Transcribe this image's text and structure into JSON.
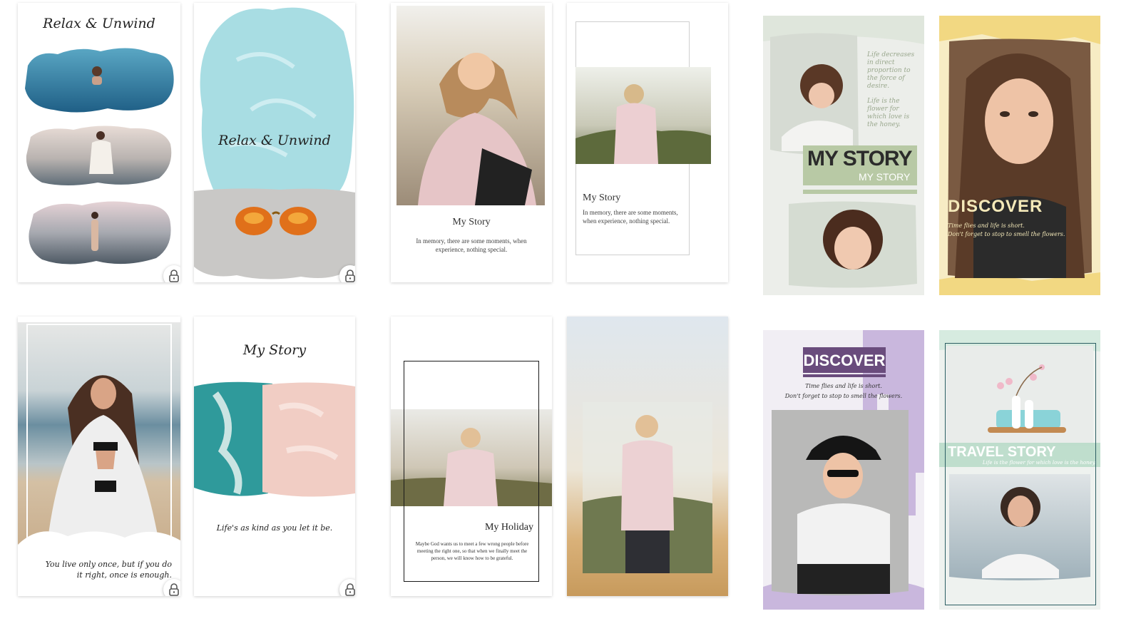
{
  "templates": {
    "t1": {
      "title": "Relax & Unwind",
      "locked": true
    },
    "t2": {
      "title": "Relax & Unwind",
      "locked": true
    },
    "t3": {
      "title": "My Story",
      "body": "In memory, there are some moments, when experience, nothing special."
    },
    "t4": {
      "title": "My Story",
      "body": "In memory, there are some moments, when experience, nothing special."
    },
    "t5": {
      "quote1": "Life decreases in direct proportion to the force of desire.",
      "quote2": "Life is the flower for which love is the honey.",
      "heading": "MY STORY",
      "subheading": "MY STORY"
    },
    "t6": {
      "heading": "DISCOVER",
      "line1": "Time flies and life is short.",
      "line2": "Don't forget to stop to smell the flowers."
    },
    "t7": {
      "caption": "You live only once, but if you do it right, once is enough.",
      "locked": true
    },
    "t8": {
      "title": "My Story",
      "caption": "Life's as kind as you let it be.",
      "locked": true
    },
    "t9": {
      "title": "My Holiday",
      "body": "Maybe God wants us to meet a few wrong people before meeting the right one, so that when we finally meet the person, we will know how to be grateful."
    },
    "t10": {},
    "t11": {
      "heading": "DISCOVER",
      "line1": "Time flies and life is short.",
      "line2": "Don't forget to stop to smell the flowers."
    },
    "t12": {
      "heading": "TRAVEL STORY",
      "line1": "Life is the flower for which love is the honey."
    }
  },
  "icons": {
    "lock": "lock-icon"
  },
  "colors": {
    "mint": "#b9dcc9",
    "sage": "#b8c9a5",
    "lavender": "#6a4c7d",
    "yellow": "#f5e3a2",
    "aqua": "#a8dde3"
  }
}
